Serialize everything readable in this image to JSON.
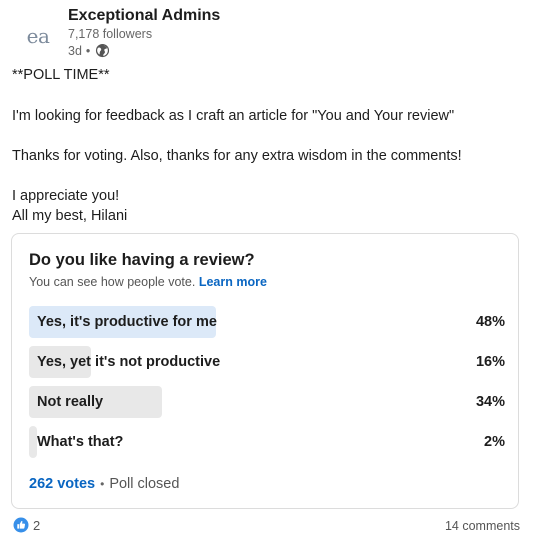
{
  "author": {
    "logo_text": "ea",
    "name": "Exceptional Admins",
    "followers": "7,178 followers",
    "time_ago": "3d",
    "separator": "•"
  },
  "post": {
    "lines": [
      "**POLL TIME**",
      "I'm looking for feedback as I craft an article for \"You and Your review\"",
      "Thanks for voting. Also, thanks for any extra wisdom in the comments!",
      "I appreciate you!",
      "All my best, Hilani"
    ]
  },
  "poll": {
    "question": "Do you like having a review?",
    "visibility_text": "You can see how people vote.",
    "learn_more": "Learn more",
    "options": [
      {
        "label": "Yes, it's productive for me",
        "percent_text": "48%",
        "percent": 48,
        "selected": true
      },
      {
        "label": "Yes, yet it's not productive",
        "percent_text": "16%",
        "percent": 16,
        "selected": false
      },
      {
        "label": "Not really",
        "percent_text": "34%",
        "percent": 34,
        "selected": false
      },
      {
        "label": "What's that?",
        "percent_text": "2%",
        "percent": 2,
        "selected": false
      }
    ],
    "votes": "262 votes",
    "footer_separator": "•",
    "status": "Poll closed"
  },
  "social": {
    "reactions_count": "2",
    "comments": "14 comments"
  },
  "colors": {
    "accent": "#0a66c2",
    "selected_fill": "#dce9f8",
    "option_fill": "#e8e8e8"
  },
  "icons": {
    "globe": "globe-icon",
    "like": "like-reaction-icon"
  }
}
